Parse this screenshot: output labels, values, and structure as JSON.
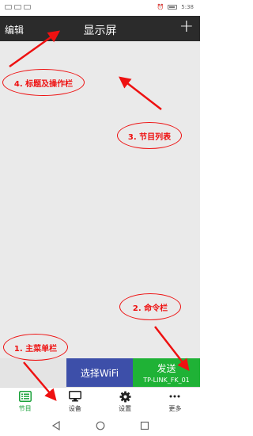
{
  "status_bar": {
    "time": "5:38"
  },
  "title_bar": {
    "edit_label": "编辑",
    "title": "显示屏",
    "add_label": "+"
  },
  "command_bar": {
    "wifi_button_label": "选择WiFi",
    "send_button_label": "发送",
    "send_ssid": "TP-LINK_FK_01"
  },
  "main_menu": {
    "items": [
      {
        "label": "节目",
        "icon": "program-list-icon",
        "active": true
      },
      {
        "label": "设备",
        "icon": "monitor-icon",
        "active": false
      },
      {
        "label": "设置",
        "icon": "gear-icon",
        "active": false
      },
      {
        "label": "更多",
        "icon": "more-icon",
        "active": false
      }
    ]
  },
  "annotations": {
    "title_bar": "4. 标题及操作栏",
    "program_list": "3. 节目列表",
    "command_bar": "2. 命令栏",
    "main_menu": "1. 主菜单栏"
  },
  "colors": {
    "title_bar_bg": "#2b2b2b",
    "wifi_button_bg": "#3d4fa9",
    "send_button_bg": "#1fb236",
    "active_tab": "#1aa13a",
    "annotation_red": "#e11111"
  }
}
